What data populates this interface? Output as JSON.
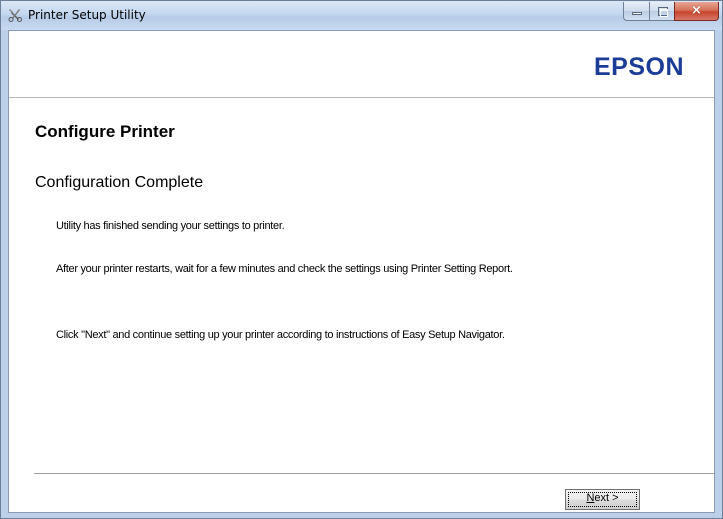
{
  "window": {
    "title": "Printer Setup Utility",
    "icon": "printer-tools-icon",
    "controls": {
      "minimize": "minimize-icon",
      "maximize": "maximize-icon",
      "close": "×"
    }
  },
  "header": {
    "brand": "EPSON",
    "brand_color": "#1b3c97"
  },
  "main": {
    "heading": "Configure Printer",
    "subheading": "Configuration Complete",
    "messages": [
      "Utility has finished sending your settings to printer.",
      "After your printer restarts, wait for a few minutes and check the settings using Printer Setting Report.",
      "Click \"Next\" and continue setting up your printer according to instructions of Easy Setup Navigator."
    ]
  },
  "footer": {
    "next_button": {
      "mnemonic": "N",
      "rest": "ext >"
    }
  }
}
